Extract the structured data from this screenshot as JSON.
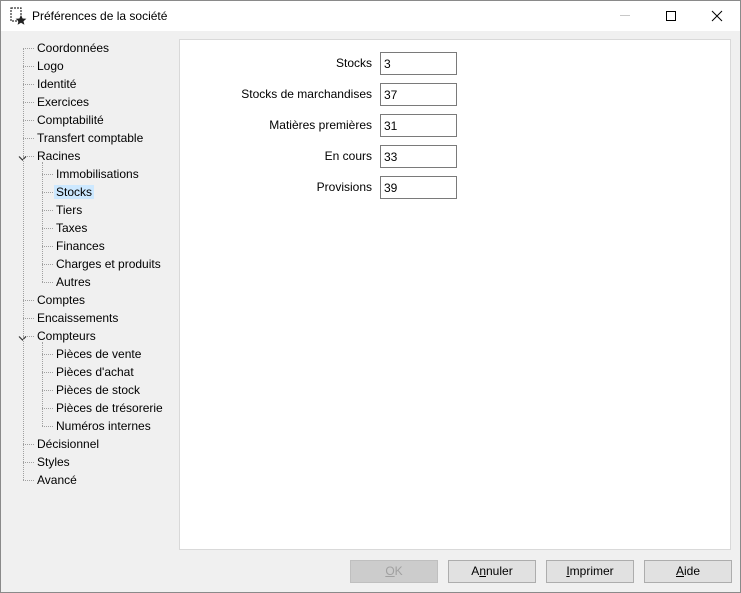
{
  "window": {
    "title": "Préférences de la société",
    "icon": "company-settings-icon"
  },
  "tree": {
    "items": [
      {
        "label": "Coordonnées",
        "level": 0
      },
      {
        "label": "Logo",
        "level": 0
      },
      {
        "label": "Identité",
        "level": 0
      },
      {
        "label": "Exercices",
        "level": 0
      },
      {
        "label": "Comptabilité",
        "level": 0
      },
      {
        "label": "Transfert comptable",
        "level": 0
      },
      {
        "label": "Racines",
        "level": 0,
        "expanded": true
      },
      {
        "label": "Immobilisations",
        "level": 1
      },
      {
        "label": "Stocks",
        "level": 1,
        "selected": true
      },
      {
        "label": "Tiers",
        "level": 1
      },
      {
        "label": "Taxes",
        "level": 1
      },
      {
        "label": "Finances",
        "level": 1
      },
      {
        "label": "Charges et produits",
        "level": 1
      },
      {
        "label": "Autres",
        "level": 1
      },
      {
        "label": "Comptes",
        "level": 0
      },
      {
        "label": "Encaissements",
        "level": 0
      },
      {
        "label": "Compteurs",
        "level": 0,
        "expanded": true
      },
      {
        "label": "Pièces de vente",
        "level": 1
      },
      {
        "label": "Pièces d'achat",
        "level": 1
      },
      {
        "label": "Pièces de stock",
        "level": 1
      },
      {
        "label": "Pièces de trésorerie",
        "level": 1
      },
      {
        "label": "Numéros internes",
        "level": 1
      },
      {
        "label": "Décisionnel",
        "level": 0
      },
      {
        "label": "Styles",
        "level": 0
      },
      {
        "label": "Avancé",
        "level": 0
      }
    ]
  },
  "form": {
    "fields": [
      {
        "label": "Stocks",
        "value": "3"
      },
      {
        "label": "Stocks de marchandises",
        "value": "37"
      },
      {
        "label": "Matières premières",
        "value": "31"
      },
      {
        "label": "En cours",
        "value": "33"
      },
      {
        "label": "Provisions",
        "value": "39"
      }
    ]
  },
  "buttons": {
    "ok": {
      "pre": "",
      "key": "O",
      "post": "K",
      "enabled": false
    },
    "annuler": {
      "pre": "A",
      "key": "n",
      "post": "nuler"
    },
    "imprimer": {
      "pre": "",
      "key": "I",
      "post": "mprimer"
    },
    "aide": {
      "pre": "",
      "key": "A",
      "post": "ide"
    }
  },
  "colors": {
    "selection": "#cce8ff",
    "panel_bg": "#ffffff",
    "window_bg": "#f0f0f0"
  }
}
